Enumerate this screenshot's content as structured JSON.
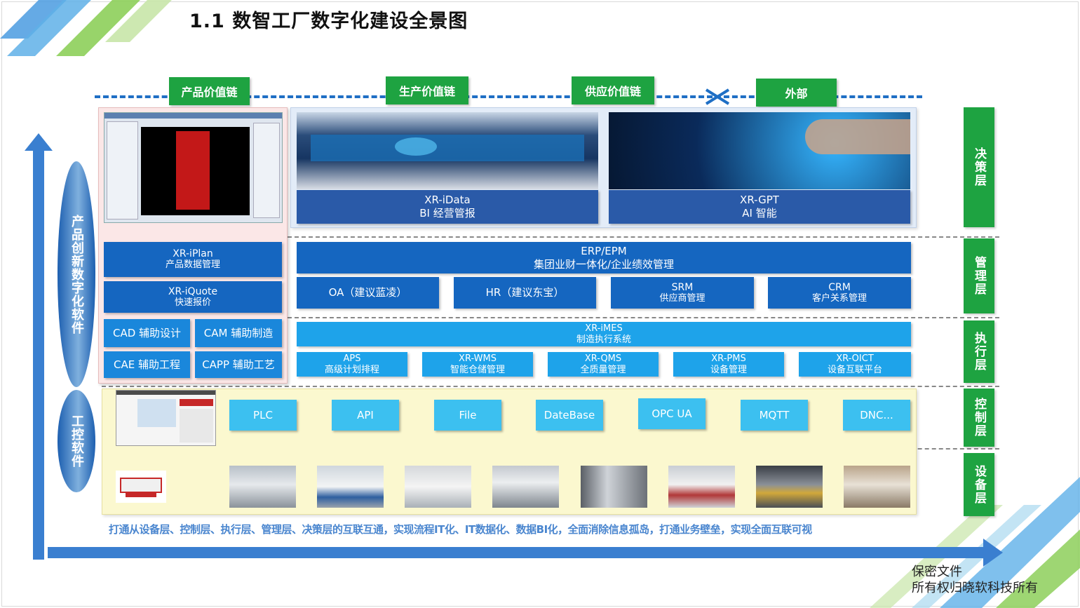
{
  "title": "1.1 数智工厂数字化建设全景图",
  "value_chain": [
    "产品价值链",
    "生产价值链",
    "供应价值链",
    "外部"
  ],
  "layers": [
    "决策层",
    "管理层",
    "执行层",
    "控制层",
    "设备层"
  ],
  "side": {
    "product_software": "产品创新数字化软件",
    "control_software": "工控软件"
  },
  "decision": {
    "idata": {
      "name": "XR-iData",
      "desc": "BI 经营管报"
    },
    "gpt": {
      "name": "XR-GPT",
      "desc": "AI 智能"
    }
  },
  "product": {
    "iplan": {
      "name": "XR-iPlan",
      "desc": "产品数据管理"
    },
    "iquote": {
      "name": "XR-iQuote",
      "desc": "快速报价"
    },
    "cad": "CAD 辅助设计",
    "cam": "CAM 辅助制造",
    "cae": "CAE 辅助工程",
    "capp": "CAPP 辅助工艺"
  },
  "management": {
    "erp": {
      "name": "ERP/EPM",
      "desc": "集团业财一体化/企业绩效管理"
    },
    "oa": "OA（建议蓝凌）",
    "hr": "HR（建议东宝）",
    "srm": {
      "name": "SRM",
      "desc": "供应商管理"
    },
    "crm": {
      "name": "CRM",
      "desc": "客户关系管理"
    }
  },
  "execution": {
    "imes": {
      "name": "XR-iMES",
      "desc": "制造执行系统"
    },
    "modules": [
      {
        "name": "APS",
        "desc": "高级计划排程"
      },
      {
        "name": "XR-WMS",
        "desc": "智能仓储管理"
      },
      {
        "name": "XR-QMS",
        "desc": "全质量管理"
      },
      {
        "name": "XR-PMS",
        "desc": "设备管理"
      },
      {
        "name": "XR-OICT",
        "desc": "设备互联平台"
      }
    ]
  },
  "control": [
    "PLC",
    "API",
    "File",
    "DateBase",
    "OPC UA",
    "MQTT",
    "DNC..."
  ],
  "bottom_text": "打通从设备层、控制层、执行层、管理层、决策层的互联互通，实现流程IT化、IT数据化、数据BI化，全面消除信息孤岛，打通业务壁垒，实现全面互联可视",
  "footer": {
    "line1": "保密文件",
    "line2": "所有权归晓软科技所有"
  },
  "colors": {
    "green": "#1ea341",
    "dark_blue": "#1566c0",
    "light_blue": "#1ea3ea",
    "yellow_bg": "#fbf8cf"
  }
}
